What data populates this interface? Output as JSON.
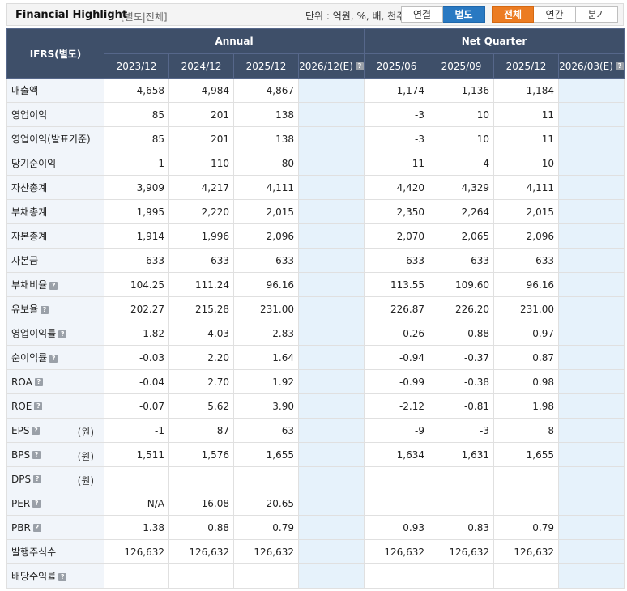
{
  "header": {
    "title": "Financial Highlight",
    "crumb": "[별도|전체]",
    "unit_text": "단위 : 억원, %, 배, 천주",
    "basis_buttons": [
      "연결",
      "별도"
    ],
    "basis_selected": 1,
    "period_buttons": [
      "전체",
      "연간",
      "분기"
    ],
    "period_selected": 0
  },
  "table": {
    "corner_label": "IFRS(별도)",
    "groups": [
      "Annual",
      "Net Quarter"
    ],
    "columns": [
      "2023/12",
      "2024/12",
      "2025/12",
      "2026/12(E)",
      "2025/06",
      "2025/09",
      "2025/12",
      "2026/03(E)"
    ],
    "estimate_columns": [
      3,
      7
    ],
    "rows": [
      {
        "label": "매출액",
        "info": false,
        "unit": "",
        "values": [
          "4,658",
          "4,984",
          "4,867",
          "",
          "1,174",
          "1,136",
          "1,184",
          ""
        ]
      },
      {
        "label": "영업이익",
        "info": false,
        "unit": "",
        "values": [
          "85",
          "201",
          "138",
          "",
          "-3",
          "10",
          "11",
          ""
        ]
      },
      {
        "label": "영업이익(발표기준)",
        "info": false,
        "unit": "",
        "values": [
          "85",
          "201",
          "138",
          "",
          "-3",
          "10",
          "11",
          ""
        ]
      },
      {
        "label": "당기순이익",
        "info": false,
        "unit": "",
        "values": [
          "-1",
          "110",
          "80",
          "",
          "-11",
          "-4",
          "10",
          ""
        ]
      },
      {
        "label": "자산총계",
        "info": false,
        "unit": "",
        "values": [
          "3,909",
          "4,217",
          "4,111",
          "",
          "4,420",
          "4,329",
          "4,111",
          ""
        ]
      },
      {
        "label": "부채총계",
        "info": false,
        "unit": "",
        "values": [
          "1,995",
          "2,220",
          "2,015",
          "",
          "2,350",
          "2,264",
          "2,015",
          ""
        ]
      },
      {
        "label": "자본총계",
        "info": false,
        "unit": "",
        "values": [
          "1,914",
          "1,996",
          "2,096",
          "",
          "2,070",
          "2,065",
          "2,096",
          ""
        ]
      },
      {
        "label": "자본금",
        "info": false,
        "unit": "",
        "values": [
          "633",
          "633",
          "633",
          "",
          "633",
          "633",
          "633",
          ""
        ]
      },
      {
        "label": "부채비율",
        "info": true,
        "unit": "",
        "values": [
          "104.25",
          "111.24",
          "96.16",
          "",
          "113.55",
          "109.60",
          "96.16",
          ""
        ]
      },
      {
        "label": "유보율",
        "info": true,
        "unit": "",
        "values": [
          "202.27",
          "215.28",
          "231.00",
          "",
          "226.87",
          "226.20",
          "231.00",
          ""
        ]
      },
      {
        "label": "영업이익률",
        "info": true,
        "unit": "",
        "values": [
          "1.82",
          "4.03",
          "2.83",
          "",
          "-0.26",
          "0.88",
          "0.97",
          ""
        ]
      },
      {
        "label": "순이익률",
        "info": true,
        "unit": "",
        "values": [
          "-0.03",
          "2.20",
          "1.64",
          "",
          "-0.94",
          "-0.37",
          "0.87",
          ""
        ]
      },
      {
        "label": "ROA",
        "info": true,
        "unit": "",
        "values": [
          "-0.04",
          "2.70",
          "1.92",
          "",
          "-0.99",
          "-0.38",
          "0.98",
          ""
        ]
      },
      {
        "label": "ROE",
        "info": true,
        "unit": "",
        "values": [
          "-0.07",
          "5.62",
          "3.90",
          "",
          "-2.12",
          "-0.81",
          "1.98",
          ""
        ]
      },
      {
        "label": "EPS",
        "info": true,
        "unit": "(원)",
        "values": [
          "-1",
          "87",
          "63",
          "",
          "-9",
          "-3",
          "8",
          ""
        ]
      },
      {
        "label": "BPS",
        "info": true,
        "unit": "(원)",
        "values": [
          "1,511",
          "1,576",
          "1,655",
          "",
          "1,634",
          "1,631",
          "1,655",
          ""
        ]
      },
      {
        "label": "DPS",
        "info": true,
        "unit": "(원)",
        "values": [
          "",
          "",
          "",
          "",
          "",
          "",
          "",
          ""
        ]
      },
      {
        "label": "PER",
        "info": true,
        "unit": "",
        "values": [
          "N/A",
          "16.08",
          "20.65",
          "",
          "",
          "",
          "",
          ""
        ]
      },
      {
        "label": "PBR",
        "info": true,
        "unit": "",
        "values": [
          "1.38",
          "0.88",
          "0.79",
          "",
          "0.93",
          "0.83",
          "0.79",
          ""
        ]
      },
      {
        "label": "발행주식수",
        "info": false,
        "unit": "",
        "values": [
          "126,632",
          "126,632",
          "126,632",
          "",
          "126,632",
          "126,632",
          "126,632",
          ""
        ]
      },
      {
        "label": "배당수익률",
        "info": true,
        "unit": "",
        "values": [
          "",
          "",
          "",
          "",
          "",
          "",
          "",
          ""
        ]
      }
    ]
  },
  "colors": {
    "header_bg": "#3e4f69",
    "label_bg": "#f1f5fa",
    "estimate_bg": "#e6f2fb",
    "negative": "#d01818",
    "basis_selected": "#2979c2",
    "period_selected": "#ec7c22"
  },
  "icons": {
    "info": "question-mark-square-icon"
  }
}
